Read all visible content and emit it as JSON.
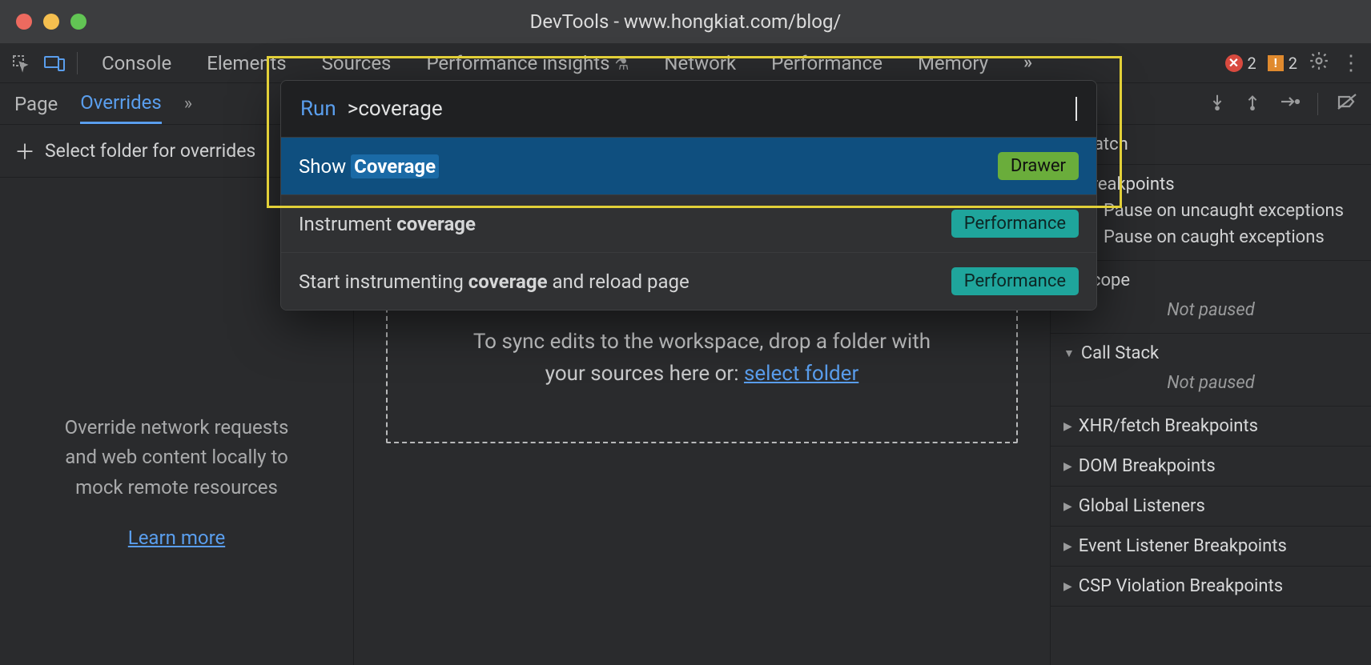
{
  "titlebar": {
    "title": "DevTools - www.hongkiat.com/blog/"
  },
  "toolbar": {
    "tabs": [
      "Console",
      "Elements",
      "Sources",
      "Performance insights",
      "Network",
      "Performance",
      "Memory"
    ],
    "activeIndex": 2,
    "error_count": "2",
    "warn_count": "2"
  },
  "sidebar": {
    "subtabs": [
      "Page",
      "Overrides"
    ],
    "activeSubtab": 1,
    "select_folder_label": "Select folder for overrides",
    "info_l1": "Override network requests",
    "info_l2": "and web content locally to",
    "info_l3": "mock remote resources",
    "learn_more": "Learn more"
  },
  "dropzone": {
    "line1": "To sync edits to the workspace, drop a folder with",
    "line2_pre": "your sources here or: ",
    "link": "select folder"
  },
  "debugger": {
    "sections": {
      "watch": "Watch",
      "breakpoints": "Breakpoints",
      "opt_uncaught": "Pause on uncaught exceptions",
      "opt_caught": "Pause on caught exceptions",
      "scope": "Scope",
      "callstack": "Call Stack",
      "xhr": "XHR/fetch Breakpoints",
      "dom": "DOM Breakpoints",
      "global": "Global Listeners",
      "event": "Event Listener Breakpoints",
      "csp": "CSP Violation Breakpoints"
    },
    "not_paused": "Not paused"
  },
  "palette": {
    "run_label": "Run",
    "input_value": ">coverage",
    "items": [
      {
        "pre": "Show ",
        "bold": "Coverage",
        "post": "",
        "tag": "Drawer",
        "tagClass": "drawer",
        "selected": true,
        "hlBold": true
      },
      {
        "pre": "Instrument ",
        "bold": "coverage",
        "post": "",
        "tag": "Performance",
        "tagClass": "perf",
        "selected": false,
        "hlBold": false
      },
      {
        "pre": "Start instrumenting ",
        "bold": "coverage",
        "post": " and reload page",
        "tag": "Performance",
        "tagClass": "perf",
        "selected": false,
        "hlBold": false
      }
    ]
  }
}
